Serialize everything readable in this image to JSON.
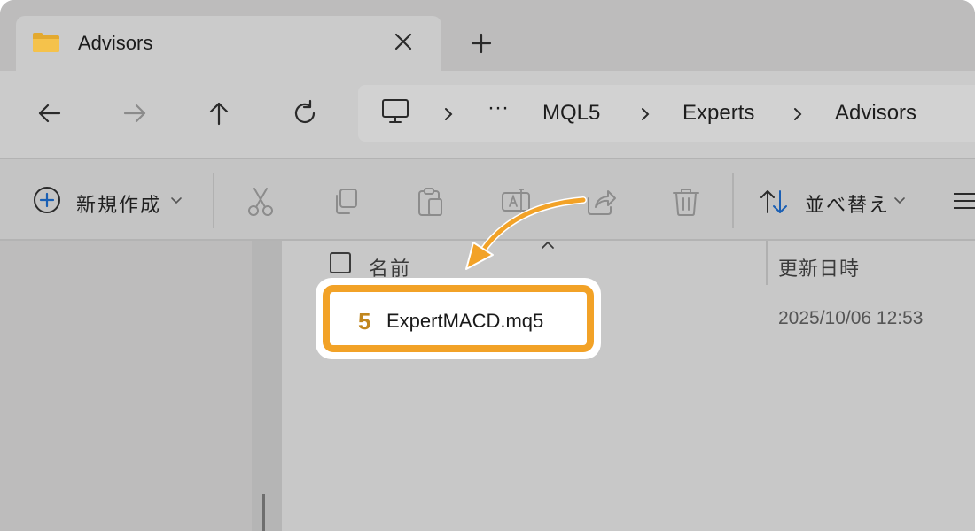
{
  "window": {
    "tab_title": "Advisors",
    "new_tab_icon": "plus-icon",
    "close_icon": "close-icon"
  },
  "nav": {
    "back_icon": "arrow-left-icon",
    "forward_icon": "arrow-right-icon",
    "up_icon": "arrow-up-icon",
    "refresh_icon": "refresh-icon",
    "breadcrumb": {
      "computer_icon": "monitor-icon",
      "ellipsis": "···",
      "items": [
        "MQL5",
        "Experts",
        "Advisors"
      ]
    }
  },
  "toolbar": {
    "new_label": "新規作成",
    "sort_label": "並べ替え",
    "icons": [
      "cut-icon",
      "copy-icon",
      "paste-icon",
      "rename-icon",
      "share-icon",
      "delete-icon"
    ]
  },
  "list": {
    "column_name": "名前",
    "column_date": "更新日時",
    "files": [
      {
        "name": "ExpertMACD.mq5",
        "icon_glyph": "5",
        "modified": "2025/10/06 12:53"
      }
    ]
  },
  "colors": {
    "highlight": "#f2a227",
    "mq5_icon": "#c1871e",
    "accent_blue": "#1a5fb4"
  }
}
